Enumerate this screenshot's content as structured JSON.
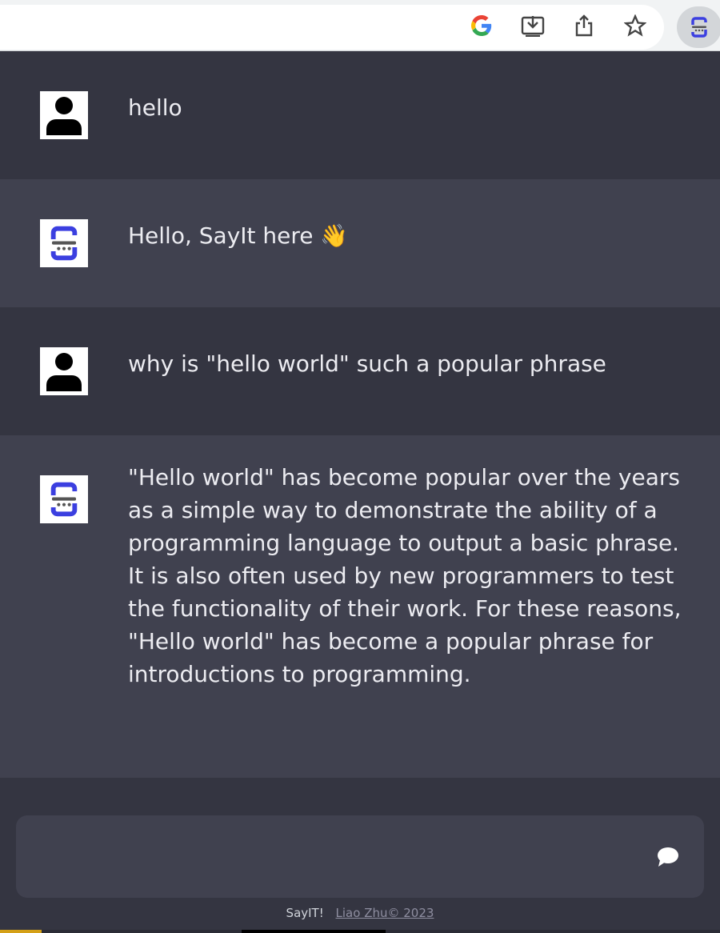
{
  "browser": {
    "icons": [
      "google-icon",
      "download-icon",
      "share-icon",
      "bookmark-star-icon",
      "sayit-extension-icon"
    ]
  },
  "messages": [
    {
      "role": "user",
      "avatar": "user-avatar-icon",
      "text": "hello"
    },
    {
      "role": "assistant",
      "avatar": "sayit-logo-icon",
      "text": "Hello, SayIt here 👋"
    },
    {
      "role": "user",
      "avatar": "user-avatar-icon",
      "text": "why is \"hello world\" such a popular phrase"
    },
    {
      "role": "assistant",
      "avatar": "sayit-logo-icon",
      "text": "\"Hello world\" has become popular over the years as a simple way to demonstrate the ability of a programming language to output a basic phrase. It is also often used by new programmers to test the functionality of their work. For these reasons, \"Hello world\" has become a popular phrase for introductions to programming."
    }
  ],
  "input": {
    "value": "",
    "send_icon": "chat-bubble-icon"
  },
  "footer": {
    "brand": "SayIT!",
    "credit": "Liao Zhu© 2023"
  },
  "colors": {
    "user_bg": "#343541",
    "assistant_bg": "#40414f",
    "logo_blue": "#3b3fe0"
  }
}
